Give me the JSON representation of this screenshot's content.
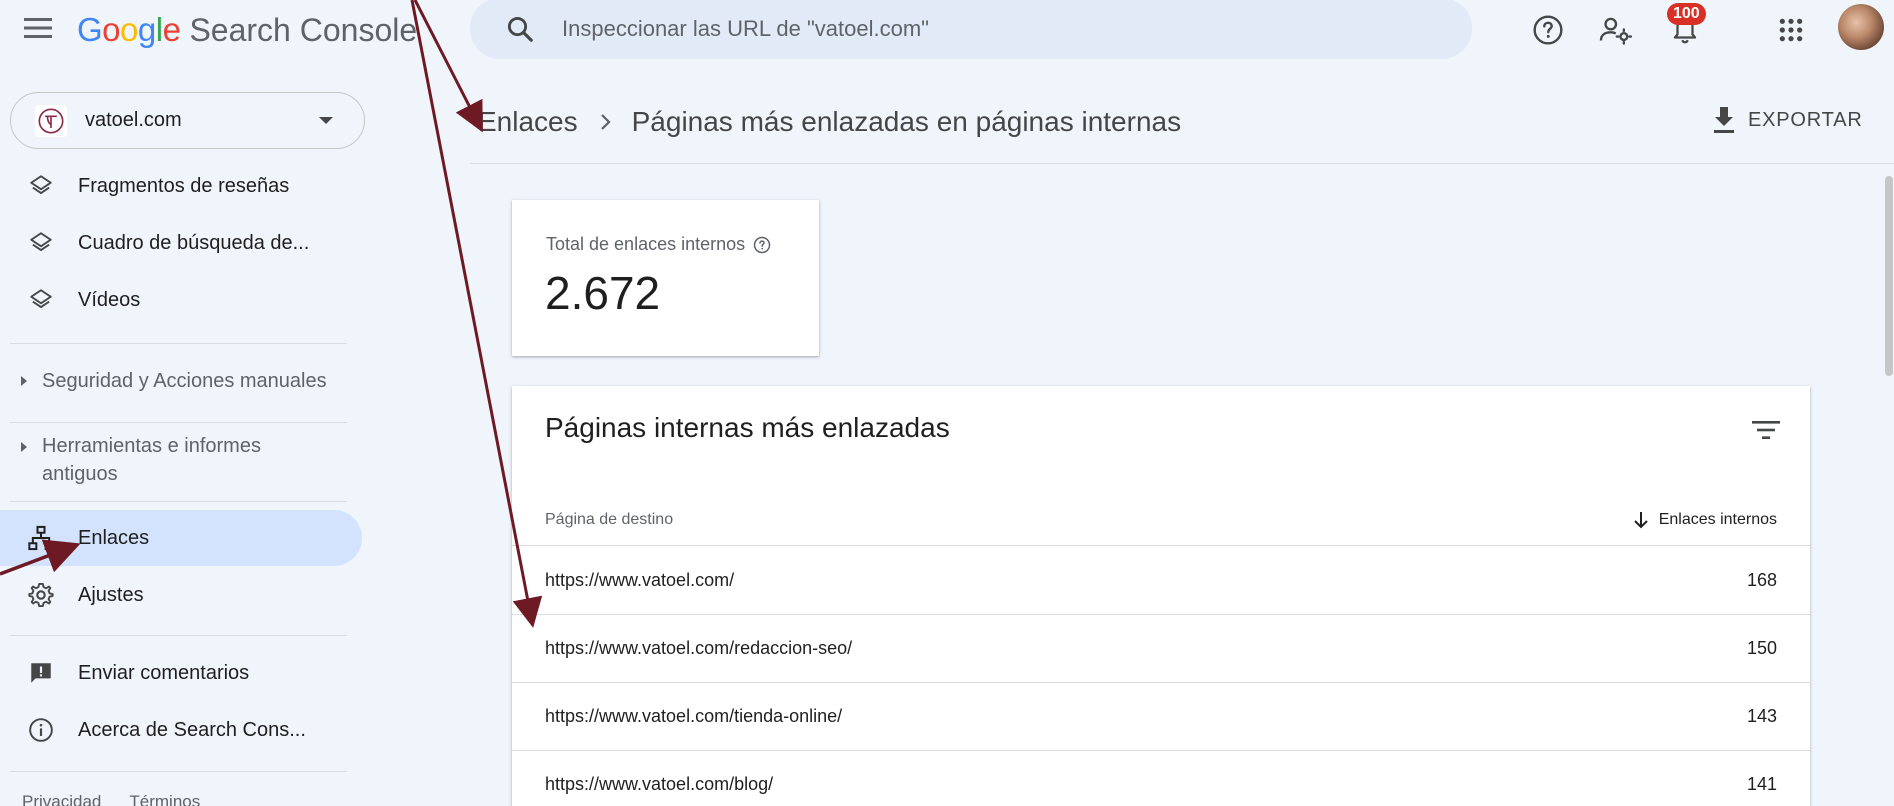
{
  "app": {
    "logo_text": "Google",
    "product_name": "Search Console"
  },
  "search": {
    "placeholder": "Inspeccionar las URL de \"vatoel.com\""
  },
  "topbar": {
    "notifications_count": "100",
    "icons": [
      "help-icon",
      "manage-users-icon",
      "notifications-icon",
      "apps-icon",
      "account-avatar"
    ]
  },
  "property": {
    "name": "vatoel.com"
  },
  "sidebar": {
    "items": [
      {
        "label": "Fragmentos de reseñas",
        "icon": "layers-icon"
      },
      {
        "label": "Cuadro de búsqueda de...",
        "icon": "layers-icon"
      },
      {
        "label": "Vídeos",
        "icon": "layers-icon"
      }
    ],
    "security_section": "Seguridad y Acciones manuales",
    "legacy_section": "Herramientas e informes antiguos",
    "links_item": "Enlaces",
    "settings_item": "Ajustes",
    "feedback_item": "Enviar comentarios",
    "about_item": "Acerca de Search Cons...",
    "footer": {
      "privacy": "Privacidad",
      "terms": "Términos"
    }
  },
  "header": {
    "breadcrumb_parent": "Enlaces",
    "breadcrumb_current": "Páginas más enlazadas en páginas internas",
    "export_label": "EXPORTAR"
  },
  "summary": {
    "label": "Total de enlaces internos",
    "value": "2.672"
  },
  "table": {
    "title": "Páginas internas más enlazadas",
    "columns": [
      "Página de destino",
      "Enlaces internos"
    ],
    "rows": [
      {
        "url": "https://www.vatoel.com/",
        "count": "168"
      },
      {
        "url": "https://www.vatoel.com/redaccion-seo/",
        "count": "150"
      },
      {
        "url": "https://www.vatoel.com/tienda-online/",
        "count": "143"
      },
      {
        "url": "https://www.vatoel.com/blog/",
        "count": "141"
      }
    ]
  },
  "colors": {
    "background": "#f0f4fb",
    "search_bg": "#e3eaf7",
    "active_nav": "#d3e3fd",
    "badge": "#d93025",
    "annotation_arrow": "#6e1a24"
  }
}
